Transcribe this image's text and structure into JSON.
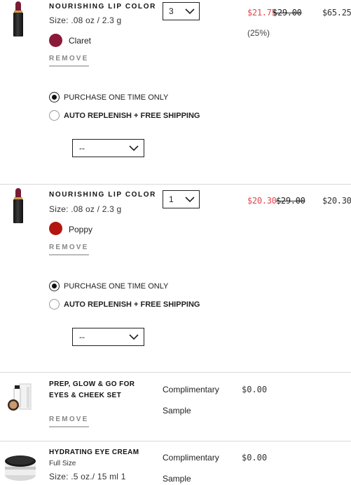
{
  "items": [
    {
      "title": "NOURISHING LIP COLOR",
      "size": "Size: .08 oz / 2.3 g",
      "shade": "Claret",
      "shade_color": "#8b1a3a",
      "remove": "REMOVE",
      "qty": "3",
      "sale_price": "$21.75",
      "orig_price": "$29.00",
      "discount": "(25%)",
      "total": "$65.25",
      "purchase_once": "PURCHASE ONE TIME ONLY",
      "auto_replenish": "AUTO REPLENISH + FREE SHIPPING",
      "frequency": "--"
    },
    {
      "title": "NOURISHING LIP COLOR",
      "size": "Size: .08 oz / 2.3 g",
      "shade": "Poppy",
      "shade_color": "#b3160e",
      "remove": "REMOVE",
      "qty": "1",
      "sale_price": "$20.30",
      "orig_price": "$29.00",
      "total": "$20.30",
      "purchase_once": "PURCHASE ONE TIME ONLY",
      "auto_replenish": "AUTO REPLENISH + FREE SHIPPING",
      "frequency": "--"
    }
  ],
  "samples": [
    {
      "title": "PREP, GLOW & GO FOR EYES & CHEEK SET",
      "label_line1": "Complimentary",
      "label_line2": "Sample",
      "price": "$0.00",
      "remove": "REMOVE"
    },
    {
      "title": "HYDRATING EYE CREAM",
      "subtitle": "Full Size",
      "size": "Size: .5 oz./ 15 ml 1",
      "label_line1": "Complimentary",
      "label_line2": "Sample",
      "price": "$0.00"
    }
  ]
}
